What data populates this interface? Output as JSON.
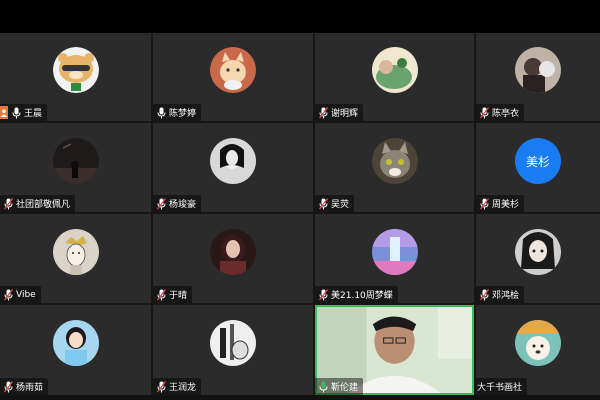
{
  "participants": [
    {
      "name": "王晨",
      "host": true,
      "mic": "on",
      "avatar_bg": "#f2f2f2",
      "avatar_kind": "bear"
    },
    {
      "name": "陈梦婷",
      "host": false,
      "mic": "on",
      "avatar_bg": "#c9694a",
      "avatar_kind": "cat"
    },
    {
      "name": "谢明辉",
      "host": false,
      "mic": "muted",
      "avatar_bg": "#6aa36f",
      "avatar_kind": "photo-green"
    },
    {
      "name": "陈亭衣",
      "host": false,
      "mic": "muted",
      "avatar_bg": "#4a3a36",
      "avatar_kind": "photo-dark"
    },
    {
      "name": "社团部敬佩凡",
      "host": false,
      "mic": "muted",
      "avatar_bg": "#1e1a1a",
      "avatar_kind": "photo-night"
    },
    {
      "name": "杨竣豪",
      "host": false,
      "mic": "muted",
      "avatar_bg": "#d8d8d8",
      "avatar_kind": "photo-bw"
    },
    {
      "name": "吴荧",
      "host": false,
      "mic": "muted",
      "avatar_bg": "#8a8577",
      "avatar_kind": "photo-cat"
    },
    {
      "name": "周美杉",
      "host": false,
      "mic": "muted",
      "avatar_bg": "#1a7cf2",
      "avatar_kind": "text",
      "avatar_text": "美杉"
    },
    {
      "name": "Vibe",
      "host": false,
      "mic": "muted",
      "avatar_bg": "#d9d3c8",
      "avatar_kind": "drawing"
    },
    {
      "name": "于晴",
      "host": false,
      "mic": "muted",
      "avatar_bg": "#6a2b2b",
      "avatar_kind": "photo-girl"
    },
    {
      "name": "美21.10周梦蝶",
      "host": false,
      "mic": "muted",
      "avatar_bg": "#7c8fd8",
      "avatar_kind": "photo-pastel"
    },
    {
      "name": "邓鸿桧",
      "host": false,
      "mic": "muted",
      "avatar_bg": "#cfcfcf",
      "avatar_kind": "photo-anime"
    },
    {
      "name": "杨雨茹",
      "host": false,
      "mic": "muted",
      "avatar_bg": "#a7d7f0",
      "avatar_kind": "photo-doll"
    },
    {
      "name": "王润龙",
      "host": false,
      "mic": "muted",
      "avatar_bg": "#efefef",
      "avatar_kind": "photo-sketch"
    },
    {
      "name": "靳伦建",
      "host": false,
      "mic": "on-green",
      "video": true
    },
    {
      "name": "大千书画社",
      "host": false,
      "mic": "none",
      "avatar_bg": "#7cc2b8",
      "avatar_kind": "photo-dog"
    }
  ],
  "colors": {
    "tile_bg": "#2b2b2b",
    "active_border": "#3cb95b",
    "host_badge": "#e8793a",
    "muted_red": "#e24a4a"
  }
}
